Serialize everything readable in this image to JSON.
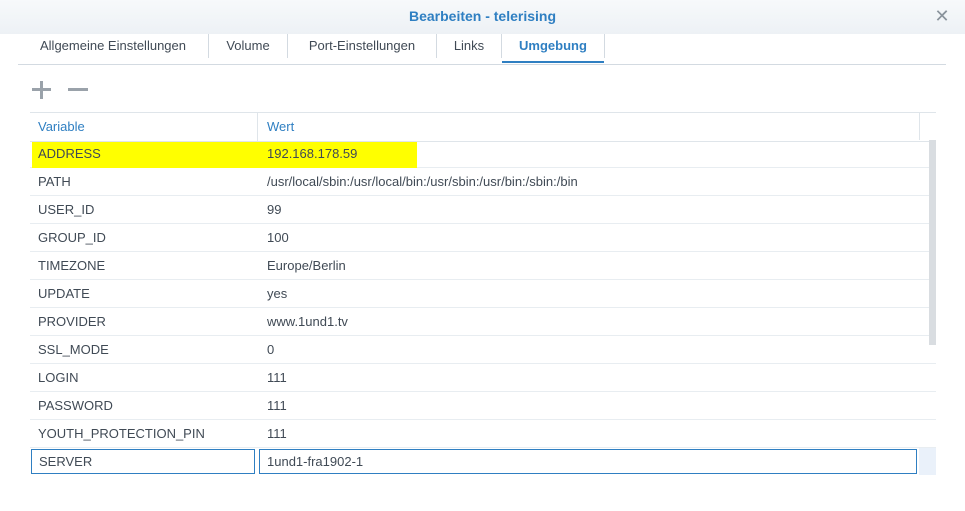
{
  "window": {
    "title": "Bearbeiten - telerising",
    "close_icon": "close-icon"
  },
  "tabs": [
    {
      "label": "Allgemeine Einstellungen",
      "active": false
    },
    {
      "label": "Volume",
      "active": false
    },
    {
      "label": "Port-Einstellungen",
      "active": false
    },
    {
      "label": "Links",
      "active": false
    },
    {
      "label": "Umgebung",
      "active": true
    }
  ],
  "toolbar": {
    "add_icon": "plus-icon",
    "remove_icon": "minus-icon"
  },
  "table": {
    "columns": [
      "Variable",
      "Wert"
    ],
    "rows": [
      {
        "variable": "ADDRESS",
        "value": "192.168.178.59",
        "highlighted": true
      },
      {
        "variable": "PATH",
        "value": "/usr/local/sbin:/usr/local/bin:/usr/sbin:/usr/bin:/sbin:/bin"
      },
      {
        "variable": "USER_ID",
        "value": "99"
      },
      {
        "variable": "GROUP_ID",
        "value": "100"
      },
      {
        "variable": "TIMEZONE",
        "value": "Europe/Berlin"
      },
      {
        "variable": "UPDATE",
        "value": "yes"
      },
      {
        "variable": "PROVIDER",
        "value": "www.1und1.tv"
      },
      {
        "variable": "SSL_MODE",
        "value": "0"
      },
      {
        "variable": "LOGIN",
        "value": "111"
      },
      {
        "variable": "PASSWORD",
        "value": "111"
      },
      {
        "variable": "YOUTH_PROTECTION_PIN",
        "value": "111"
      },
      {
        "variable": "SERVER",
        "value": "1und1-fra1902-1",
        "editing": true
      }
    ]
  },
  "colors": {
    "accent": "#2f7fc2",
    "highlight": "#ffff00",
    "text": "#404a55"
  }
}
